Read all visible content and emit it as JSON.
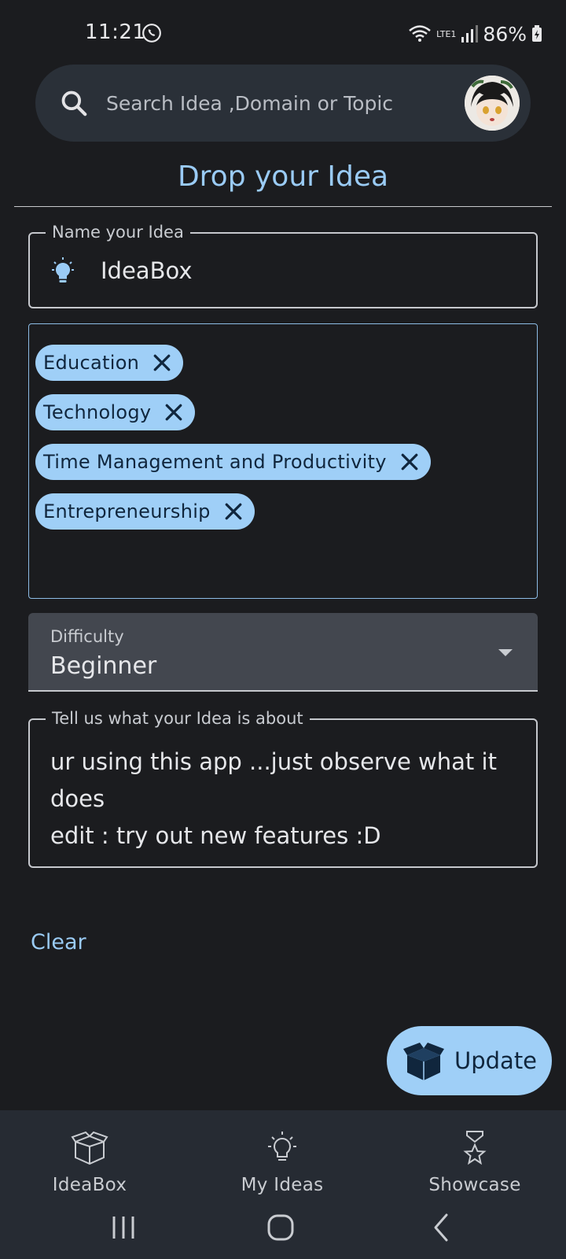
{
  "status_bar": {
    "time": "11:21",
    "battery": "86%",
    "network": "LTE1"
  },
  "search": {
    "placeholder": "Search Idea ,Domain or Topic"
  },
  "page": {
    "title": "Drop your Idea"
  },
  "form": {
    "name_label": "Name your Idea",
    "name_value": "IdeaBox",
    "tags": [
      "Education",
      "Technology",
      "Time Management and Productivity",
      "Entrepreneurship"
    ],
    "difficulty_label": "Difficulty",
    "difficulty_value": "Beginner",
    "description_label": "Tell us what your Idea is about",
    "description_value": "ur using this app ...just observe what it does\nedit : try out new features :D",
    "clear_label": "Clear",
    "update_label": "Update"
  },
  "bottom_nav": {
    "items": [
      {
        "label": "IdeaBox",
        "icon": "box-icon"
      },
      {
        "label": "My Ideas",
        "icon": "lightbulb-icon"
      },
      {
        "label": "Showcase",
        "icon": "trophy-icon"
      }
    ]
  },
  "colors": {
    "accent": "#9acbf5",
    "chip_bg": "#9fcff7",
    "background": "#1b1c1f",
    "nav_bg": "#262b33"
  }
}
